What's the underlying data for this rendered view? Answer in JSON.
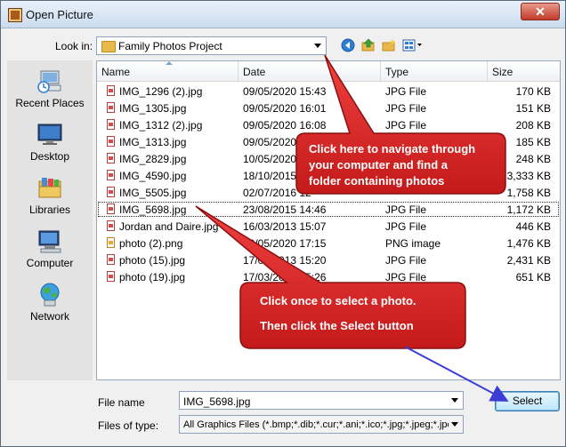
{
  "window": {
    "title": "Open Picture",
    "close_glyph": "✕"
  },
  "lookin": {
    "label": "Look in:",
    "value": "Family Photos Project"
  },
  "places": [
    {
      "label": "Recent Places",
      "icon": "recent-places-icon"
    },
    {
      "label": "Desktop",
      "icon": "desktop-icon"
    },
    {
      "label": "Libraries",
      "icon": "libraries-icon"
    },
    {
      "label": "Computer",
      "icon": "computer-icon"
    },
    {
      "label": "Network",
      "icon": "network-icon"
    }
  ],
  "columns": {
    "name": "Name",
    "date": "Date",
    "type": "Type",
    "size": "Size"
  },
  "files": [
    {
      "name": "IMG_1296 (2).jpg",
      "date": "09/05/2020 15:43",
      "type": "JPG File",
      "size": "170 KB"
    },
    {
      "name": "IMG_1305.jpg",
      "date": "09/05/2020 16:01",
      "type": "JPG File",
      "size": "151 KB"
    },
    {
      "name": "IMG_1312 (2).jpg",
      "date": "09/05/2020 16:08",
      "type": "JPG File",
      "size": "208 KB"
    },
    {
      "name": "IMG_1313.jpg",
      "date": "09/05/2020",
      "type": "",
      "size": "185 KB"
    },
    {
      "name": "IMG_2829.jpg",
      "date": "10/05/2020",
      "type": "",
      "size": "248 KB"
    },
    {
      "name": "IMG_4590.jpg",
      "date": "18/10/2015",
      "type": "",
      "size": "3,333 KB"
    },
    {
      "name": "IMG_5505.jpg",
      "date": "02/07/2016 12",
      "type": "",
      "size": "1,758 KB"
    },
    {
      "name": "IMG_5698.jpg",
      "date": "23/08/2015 14:46",
      "type": "JPG File",
      "size": "1,172 KB"
    },
    {
      "name": "Jordan and Daire.jpg",
      "date": "16/03/2013 15:07",
      "type": "JPG File",
      "size": "446 KB"
    },
    {
      "name": "photo (2).png",
      "date": "10/05/2020 17:15",
      "type": "PNG image",
      "size": "1,476 KB"
    },
    {
      "name": "photo (15).jpg",
      "date": "17/03/2013 15:20",
      "type": "JPG File",
      "size": "2,431 KB"
    },
    {
      "name": "photo (19).jpg",
      "date": "17/03/2013 15:26",
      "type": "JPG File",
      "size": "651 KB"
    }
  ],
  "selected_file_index": 7,
  "filename": {
    "label": "File name",
    "value": "IMG_5698.jpg"
  },
  "filetype": {
    "label": "Files of type:",
    "value": "All Graphics Files (*.bmp;*.dib;*.cur;*.ani;*.ico;*.jpg;*.jpeg;*.jpe;*"
  },
  "select_button": "Select",
  "callout1": {
    "lines": [
      "Click here to navigate through",
      "your computer and find a",
      "folder containing photos"
    ]
  },
  "callout2": {
    "line1": "Click once to select a photo.",
    "line2": "Then click the Select button"
  },
  "colors": {
    "callout_fill": "#e0292a",
    "callout_border": "#b51616",
    "arrow_blue": "#3b3bd6"
  }
}
